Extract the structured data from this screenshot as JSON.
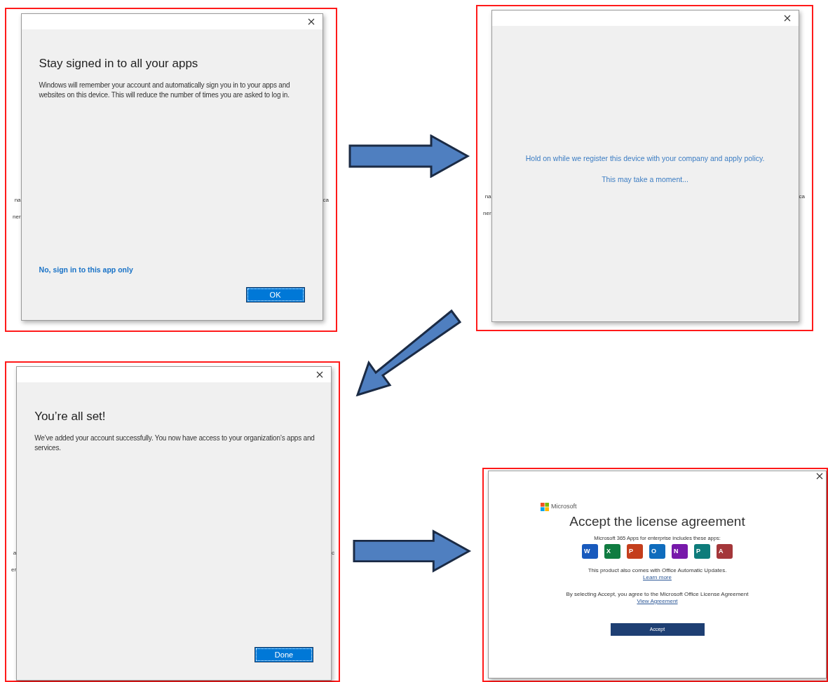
{
  "steps": [
    {
      "kind": "message",
      "title": "Stay signed in to all your apps",
      "body": "Windows will remember your account and automatically sign you in to your apps and websites on this device. This will reduce the number of times you are asked to log in.",
      "link": "No, sign in to this app only",
      "button": "OK",
      "backdrop_left": [
        "na",
        "ner"
      ],
      "backdrop_right": [
        "ca"
      ]
    },
    {
      "kind": "progress",
      "lines": [
        "Hold on while we register this device with your company and apply policy.",
        "This may take a moment..."
      ],
      "backdrop_left": [
        "na",
        "ner"
      ],
      "backdrop_right": [
        "ca"
      ]
    },
    {
      "kind": "message",
      "title": "You’re all set!",
      "body": "We’ve added your account successfully. You now have access to your organization’s apps and services.",
      "button": "Done",
      "backdrop_left": [
        "a",
        "er"
      ],
      "backdrop_right": [
        "c"
      ]
    },
    {
      "kind": "license",
      "brand": "Microsoft",
      "title": "Accept the license agreement",
      "subtitle": "Microsoft 365 Apps for enterprise includes these apps:",
      "apps": [
        {
          "letter": "W",
          "color": "#185abd"
        },
        {
          "letter": "X",
          "color": "#107c41"
        },
        {
          "letter": "P",
          "color": "#c43e1c"
        },
        {
          "letter": "O",
          "color": "#0f6cbd"
        },
        {
          "letter": "N",
          "color": "#7719aa"
        },
        {
          "letter": "P",
          "color": "#0e7c7b"
        },
        {
          "letter": "A",
          "color": "#a4373a"
        }
      ],
      "notice": "This product also comes with Office Automatic Updates.",
      "notice_link": "Learn more",
      "agreement": "By selecting Accept, you agree to the Microsoft Office License Agreement",
      "agreement_link": "View Agreement",
      "button": "Accept"
    }
  ],
  "arrows": [
    {
      "kind": "right"
    },
    {
      "kind": "diagonal"
    },
    {
      "kind": "right"
    }
  ]
}
